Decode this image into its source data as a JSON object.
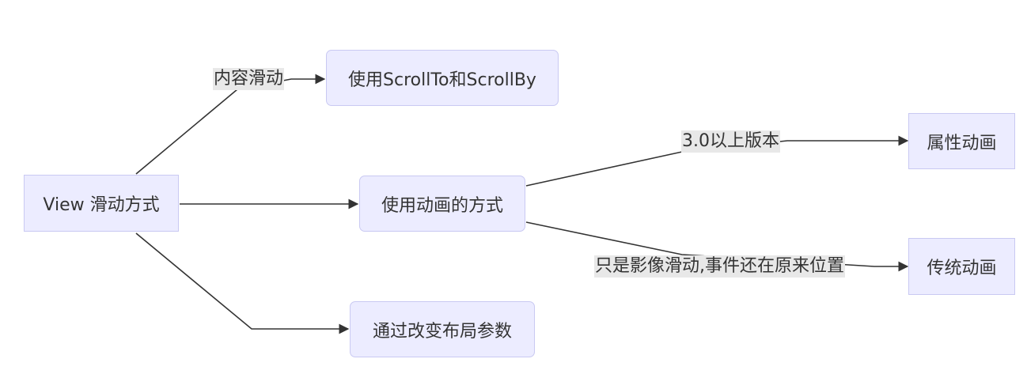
{
  "nodes": {
    "root": "View 滑动方式",
    "scroll": "使用ScrollTo和ScrollBy",
    "anim": "使用动画的方式",
    "layout": "通过改变布局参数",
    "prop": "属性动画",
    "trad": "传统动画"
  },
  "edge_labels": {
    "root_scroll": "内容滑动",
    "anim_prop": "3.0以上版本",
    "anim_trad": "只是影像滑动,事件还在原来位置"
  },
  "colors": {
    "node_fill": "#ECECFF",
    "node_border": "#C9C9F2",
    "edge": "#333333",
    "label_bg": "#E8E8E8"
  }
}
